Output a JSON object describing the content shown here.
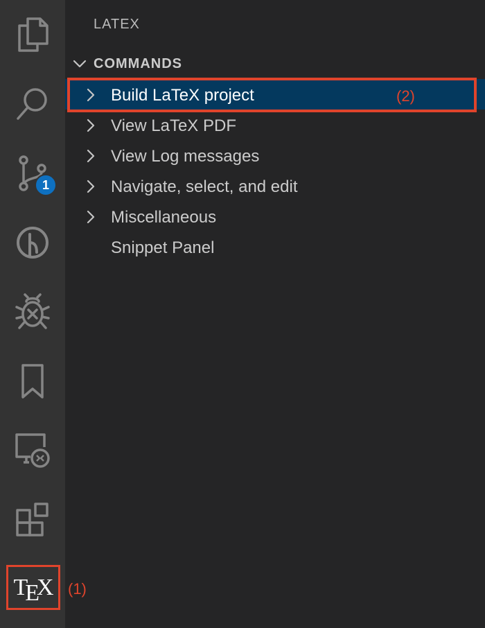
{
  "colors": {
    "activity_bar_bg": "#333333",
    "sidebar_bg": "#252526",
    "selected_row_bg": "#04395e",
    "badge_bg": "#0e70c0",
    "annotation_red": "#e0442c"
  },
  "activity_bar": {
    "items": [
      {
        "icon": "files-icon"
      },
      {
        "icon": "search-icon"
      },
      {
        "icon": "source-control-icon",
        "badge": "1"
      },
      {
        "icon": "gitlens-icon"
      },
      {
        "icon": "debug-icon"
      },
      {
        "icon": "bookmark-icon"
      },
      {
        "icon": "remote-explorer-icon"
      },
      {
        "icon": "extensions-icon"
      },
      {
        "icon": "tex-icon",
        "label_t": "T",
        "label_e": "E",
        "label_x": "X"
      }
    ]
  },
  "annotations": {
    "one": "(1)",
    "two": "(2)"
  },
  "sidebar": {
    "title": "LATEX",
    "section": "COMMANDS",
    "items": [
      {
        "label": "Build LaTeX project",
        "expandable": true,
        "selected": true
      },
      {
        "label": "View LaTeX PDF",
        "expandable": true
      },
      {
        "label": "View Log messages",
        "expandable": true
      },
      {
        "label": "Navigate, select, and edit",
        "expandable": true
      },
      {
        "label": "Miscellaneous",
        "expandable": true
      },
      {
        "label": "Snippet Panel",
        "expandable": false
      }
    ]
  }
}
